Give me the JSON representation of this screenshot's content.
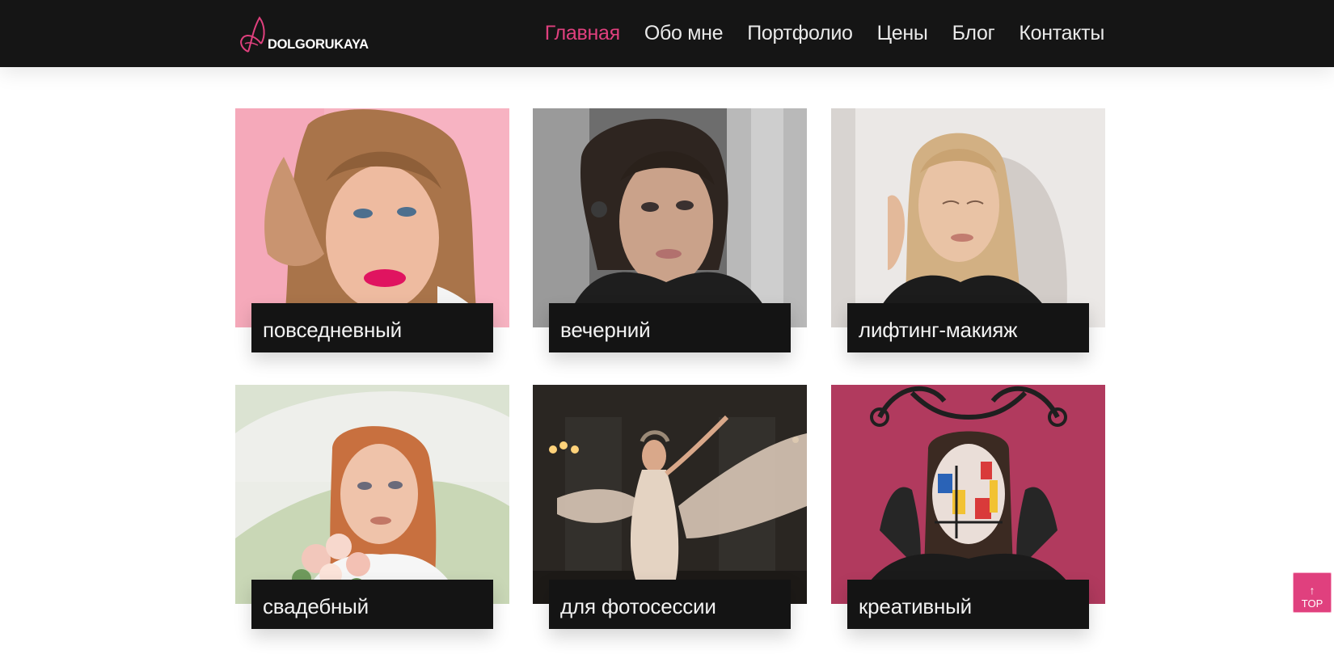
{
  "header": {
    "logo_text": "DOLGORUKAYA",
    "nav": [
      {
        "label": "Главная",
        "active": true
      },
      {
        "label": "Обо мне",
        "active": false
      },
      {
        "label": "Портфолио",
        "active": false
      },
      {
        "label": "Цены",
        "active": false
      },
      {
        "label": "Блог",
        "active": false
      },
      {
        "label": "Контакты",
        "active": false
      }
    ]
  },
  "portfolio": {
    "cards": [
      {
        "label": "повседневный",
        "photo": "woman-pink-background"
      },
      {
        "label": "вечерний",
        "photo": "woman-dreadlocks-grey-background"
      },
      {
        "label": "лифтинг-макияж",
        "photo": "blonde-woman-white-background"
      },
      {
        "label": "свадебный",
        "photo": "bride-with-veil-and-bouquet"
      },
      {
        "label": "для фотосессии",
        "photo": "woman-in-flowing-dress-dark-room"
      },
      {
        "label": "креативный",
        "photo": "creative-face-art-crimson-background"
      }
    ]
  },
  "scroll_top": {
    "label": "TOP",
    "icon": "arrow-up-icon"
  },
  "colors": {
    "header_bg": "#151515",
    "accent": "#e0407e",
    "label_bg": "#141414"
  }
}
